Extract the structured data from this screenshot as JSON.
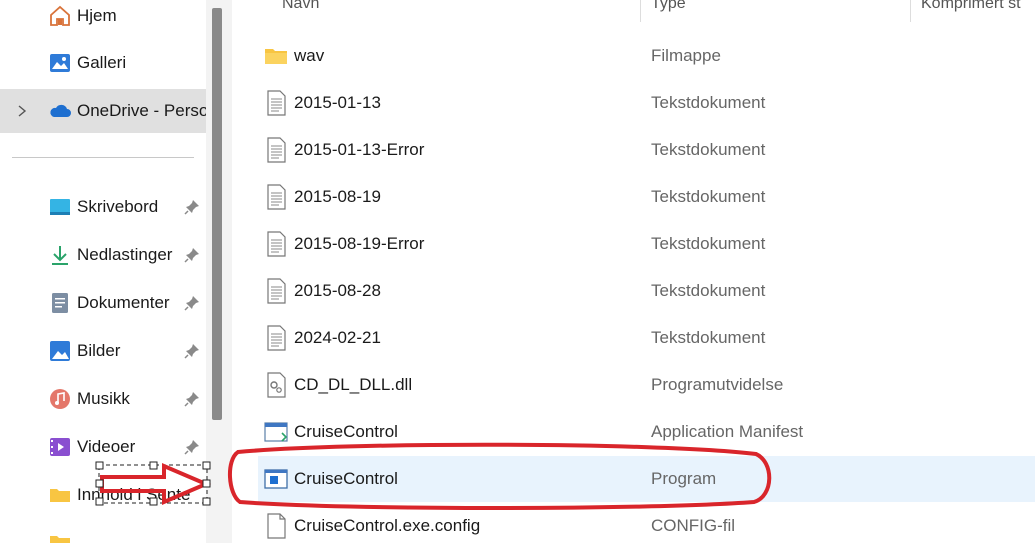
{
  "sidebar": {
    "items": [
      {
        "label": "Hjem",
        "icon": "home-icon"
      },
      {
        "label": "Galleri",
        "icon": "gallery-icon"
      },
      {
        "label": "OneDrive - Perso",
        "icon": "onedrive-cloud-icon"
      },
      {
        "label": "Skrivebord",
        "icon": "desktop-icon",
        "pinned": true
      },
      {
        "label": "Nedlastinger",
        "icon": "download-icon",
        "pinned": true
      },
      {
        "label": "Dokumenter",
        "icon": "documents-icon",
        "pinned": true
      },
      {
        "label": "Bilder",
        "icon": "pictures-icon",
        "pinned": true
      },
      {
        "label": "Musikk",
        "icon": "music-icon",
        "pinned": true
      },
      {
        "label": "Videoer",
        "icon": "videos-icon",
        "pinned": true
      },
      {
        "label": "Innhold i Sente",
        "icon": "folder-icon"
      }
    ]
  },
  "header": {
    "name": "Navn",
    "type": "Type",
    "compressed": "Komprimert st"
  },
  "files": [
    {
      "name": "wav",
      "type": "Filmappe",
      "icon": "folder-icon"
    },
    {
      "name": "2015-01-13",
      "type": "Tekstdokument",
      "icon": "text-document-icon"
    },
    {
      "name": "2015-01-13-Error",
      "type": "Tekstdokument",
      "icon": "text-document-icon"
    },
    {
      "name": "2015-08-19",
      "type": "Tekstdokument",
      "icon": "text-document-icon"
    },
    {
      "name": "2015-08-19-Error",
      "type": "Tekstdokument",
      "icon": "text-document-icon"
    },
    {
      "name": "2015-08-28",
      "type": "Tekstdokument",
      "icon": "text-document-icon"
    },
    {
      "name": "2024-02-21",
      "type": "Tekstdokument",
      "icon": "text-document-icon"
    },
    {
      "name": "CD_DL_DLL.dll",
      "type": "Programutvidelse",
      "icon": "dll-icon"
    },
    {
      "name": "CruiseControl",
      "type": "Application Manifest",
      "icon": "manifest-icon"
    },
    {
      "name": "CruiseControl",
      "type": "Program",
      "icon": "program-icon",
      "selected": true
    },
    {
      "name": "CruiseControl.exe.config",
      "type": "CONFIG-fil",
      "icon": "config-file-icon"
    }
  ],
  "colors": {
    "selected_row": "#e8f3fd",
    "sidebar_selected": "#e0e0e0",
    "annotation_red": "#d9252b",
    "folder_yellow": "#f8c542",
    "accent_blue": "#1e6fd0"
  }
}
